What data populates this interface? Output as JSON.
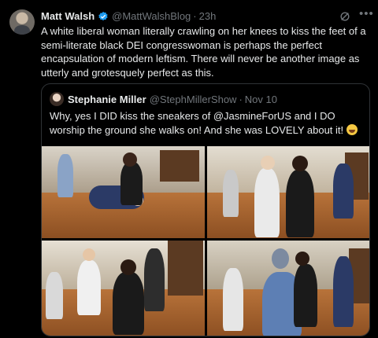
{
  "tweet": {
    "author_name": "Matt Walsh",
    "handle": "@MattWalshBlog",
    "separator": "·",
    "time": "23h",
    "text": "A white liberal woman literally crawling on her knees to kiss the feet of a semi-literate black DEI congresswoman is perhaps the perfect encapsulation of modern leftism. There will never be another image as utterly and grotesquely perfect as this.",
    "icons": {
      "verified": "verified-badge-icon",
      "grok": "grok-icon",
      "more": "more-icon"
    }
  },
  "quote": {
    "author_name": "Stephanie Miller",
    "handle": "@StephMillerShow",
    "separator": "·",
    "time": "Nov 10",
    "text": "Why, yes I DID kiss the sneakers of @JasmineForUS and I DO worship the ground she walks on! And she was LOVELY about it!",
    "emoji": "rolling-on-floor-laughing-emoji",
    "photos": [
      "photo-1",
      "photo-2",
      "photo-3",
      "photo-4"
    ]
  },
  "colors": {
    "background": "#000000",
    "text": "#e7e9ea",
    "muted": "#71767b",
    "verified": "#1d9bf0",
    "border": "#2f3336"
  }
}
